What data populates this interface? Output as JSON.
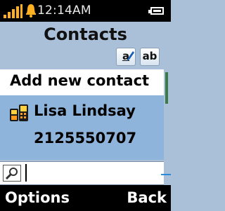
{
  "status": {
    "time": "12:14AM",
    "signal_icon": "signal-strength-icon",
    "alert_icon": "bell-icon",
    "battery_icon": "battery-icon"
  },
  "header": {
    "title": "Contacts"
  },
  "input_modes": {
    "pen_label": "a",
    "ab_label": "ab"
  },
  "list": {
    "add_label": "Add new contact",
    "contacts": [
      {
        "name": "Lisa Lindsay",
        "number": "2125550707",
        "icon": "mobile-phone-icon"
      }
    ]
  },
  "search": {
    "value": "",
    "icon": "magnifier-icon"
  },
  "softkeys": {
    "left": "Options",
    "right": "Back"
  },
  "colors": {
    "background": "#a9c0d8",
    "selected_row": "#8fb4dc",
    "status_bar": "#000000",
    "signal": "#ffb020"
  }
}
